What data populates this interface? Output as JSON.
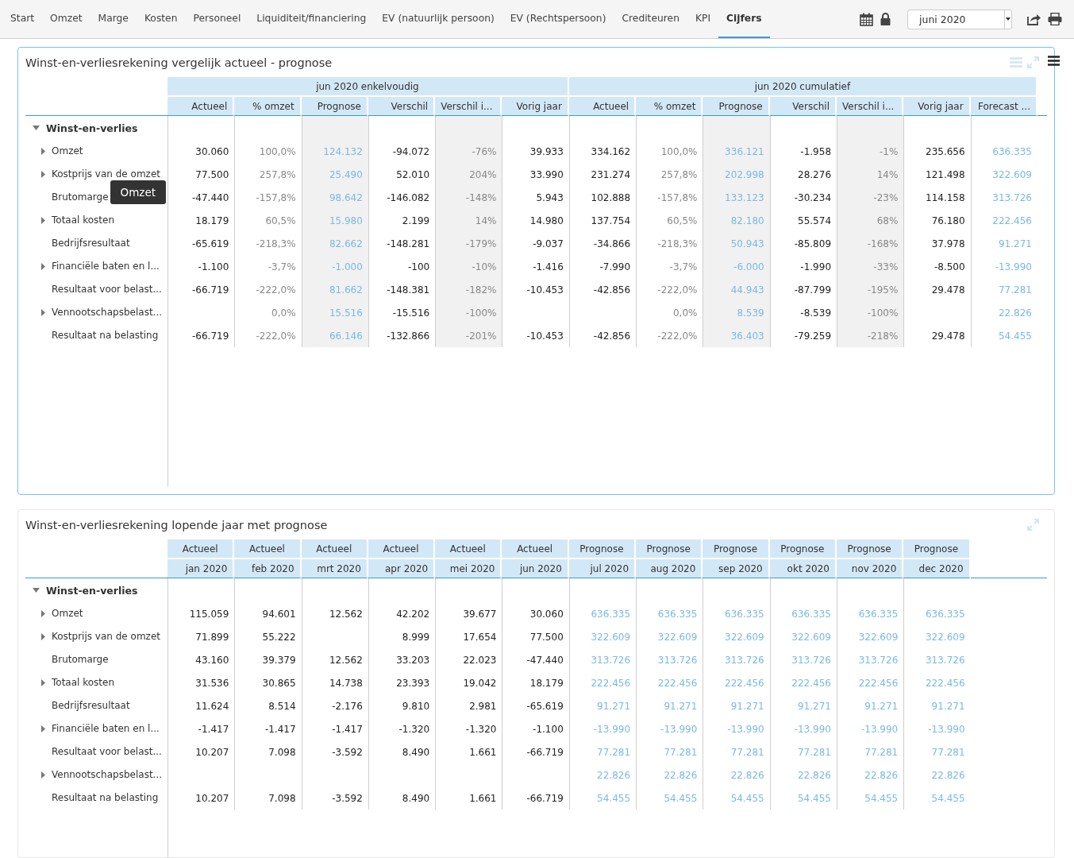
{
  "nav": {
    "items": [
      {
        "label": "Start",
        "selected": false
      },
      {
        "label": "Omzet",
        "selected": false
      },
      {
        "label": "Marge",
        "selected": false
      },
      {
        "label": "Kosten",
        "selected": false
      },
      {
        "label": "Personeel",
        "selected": false
      },
      {
        "label": "Liquiditeit/financiering",
        "selected": false
      },
      {
        "label": "EV (natuurlijk persoon)",
        "selected": false
      },
      {
        "label": "EV (Rechtspersoon)",
        "selected": false
      },
      {
        "label": "Crediteuren",
        "selected": false
      },
      {
        "label": "KPI",
        "selected": false
      },
      {
        "label": "Cijfers",
        "selected": true
      }
    ],
    "period": "juni 2020"
  },
  "panels": [
    {
      "title": "Winst-en-verliesrekening vergelijk actueel - prognose",
      "focused": true,
      "tooltip": "Omzet",
      "groups": [
        {
          "label": "jun 2020 enkelvoudig",
          "columns": [
            {
              "label": "Actueel",
              "kind": "value",
              "shaded": false
            },
            {
              "label": "% omzet",
              "kind": "pct",
              "shaded": false
            },
            {
              "label": "Prognose",
              "kind": "forecast",
              "shaded": true
            },
            {
              "label": "Verschil",
              "kind": "value",
              "shaded": false
            },
            {
              "label": "Verschil i...",
              "kind": "pct",
              "shaded": true
            },
            {
              "label": "Vorig jaar",
              "kind": "value",
              "shaded": false
            }
          ]
        },
        {
          "label": "jun 2020 cumulatief",
          "columns": [
            {
              "label": "Actueel",
              "kind": "value",
              "shaded": false
            },
            {
              "label": "% omzet",
              "kind": "pct",
              "shaded": false
            },
            {
              "label": "Prognose",
              "kind": "forecast",
              "shaded": true
            },
            {
              "label": "Verschil",
              "kind": "value",
              "shaded": false
            },
            {
              "label": "Verschil i...",
              "kind": "pct",
              "shaded": true
            },
            {
              "label": "Vorig jaar",
              "kind": "value",
              "shaded": false
            },
            {
              "label": "Forecast ...",
              "kind": "forecast",
              "shaded": false
            }
          ]
        }
      ],
      "root": {
        "label": "Winst-en-verlies",
        "expanded": true,
        "children": [
          {
            "label": "Omzet",
            "expandable": true,
            "values": [
              "30.060",
              "100,0%",
              "124.132",
              "-94.072",
              "-76%",
              "39.933",
              "334.162",
              "100,0%",
              "336.121",
              "-1.958",
              "-1%",
              "235.656",
              "636.335"
            ]
          },
          {
            "label": "Kostprijs van de omzet",
            "expandable": true,
            "values": [
              "77.500",
              "257,8%",
              "25.490",
              "52.010",
              "204%",
              "33.990",
              "231.274",
              "257,8%",
              "202.998",
              "28.276",
              "14%",
              "121.498",
              "322.609"
            ]
          },
          {
            "label": "Brutomarge",
            "expandable": false,
            "values": [
              "-47.440",
              "-157,8%",
              "98.642",
              "-146.082",
              "-148%",
              "5.943",
              "102.888",
              "-157,8%",
              "133.123",
              "-30.234",
              "-23%",
              "114.158",
              "313.726"
            ]
          },
          {
            "label": "Totaal kosten",
            "expandable": true,
            "values": [
              "18.179",
              "60,5%",
              "15.980",
              "2.199",
              "14%",
              "14.980",
              "137.754",
              "60,5%",
              "82.180",
              "55.574",
              "68%",
              "76.180",
              "222.456"
            ]
          },
          {
            "label": "Bedrijfsresultaat",
            "expandable": false,
            "values": [
              "-65.619",
              "-218,3%",
              "82.662",
              "-148.281",
              "-179%",
              "-9.037",
              "-34.866",
              "-218,3%",
              "50.943",
              "-85.809",
              "-168%",
              "37.978",
              "91.271"
            ]
          },
          {
            "label": "Financiële baten en l...",
            "expandable": true,
            "values": [
              "-1.100",
              "-3,7%",
              "-1.000",
              "-100",
              "-10%",
              "-1.416",
              "-7.990",
              "-3,7%",
              "-6.000",
              "-1.990",
              "-33%",
              "-8.500",
              "-13.990"
            ]
          },
          {
            "label": "Resultaat voor belast...",
            "expandable": false,
            "values": [
              "-66.719",
              "-222,0%",
              "81.662",
              "-148.381",
              "-182%",
              "-10.453",
              "-42.856",
              "-222,0%",
              "44.943",
              "-87.799",
              "-195%",
              "29.478",
              "77.281"
            ]
          },
          {
            "label": "Vennootschapsbelast...",
            "expandable": true,
            "values": [
              {
                "empty": true
              },
              "0,0%",
              "15.516",
              "-15.516",
              "-100%",
              {
                "empty": true
              },
              {
                "empty": true
              },
              "0,0%",
              "8.539",
              "-8.539",
              "-100%",
              {
                "empty": true
              },
              "22.826"
            ]
          },
          {
            "label": "Resultaat na belasting",
            "expandable": false,
            "values": [
              "-66.719",
              "-222,0%",
              "66.146",
              "-132.866",
              "-201%",
              "-10.453",
              "-42.856",
              "-222,0%",
              "36.403",
              "-79.259",
              "-218%",
              "29.478",
              "54.455"
            ]
          }
        ]
      }
    },
    {
      "title": "Winst-en-verliesrekening lopende jaar met prognose",
      "focused": false,
      "columns": [
        {
          "label": "Actueel",
          "sublabel": "jan 2020",
          "kind": "value"
        },
        {
          "label": "Actueel",
          "sublabel": "feb 2020",
          "kind": "value"
        },
        {
          "label": "Actueel",
          "sublabel": "mrt 2020",
          "kind": "value"
        },
        {
          "label": "Actueel",
          "sublabel": "apr 2020",
          "kind": "value"
        },
        {
          "label": "Actueel",
          "sublabel": "mei 2020",
          "kind": "value"
        },
        {
          "label": "Actueel",
          "sublabel": "jun 2020",
          "kind": "value"
        },
        {
          "label": "Prognose",
          "sublabel": "jul 2020",
          "kind": "forecast"
        },
        {
          "label": "Prognose",
          "sublabel": "aug 2020",
          "kind": "forecast"
        },
        {
          "label": "Prognose",
          "sublabel": "sep 2020",
          "kind": "forecast"
        },
        {
          "label": "Prognose",
          "sublabel": "okt 2020",
          "kind": "forecast"
        },
        {
          "label": "Prognose",
          "sublabel": "nov 2020",
          "kind": "forecast"
        },
        {
          "label": "Prognose",
          "sublabel": "dec 2020",
          "kind": "forecast"
        }
      ],
      "root": {
        "label": "Winst-en-verlies",
        "expanded": true,
        "children": [
          {
            "label": "Omzet",
            "expandable": true,
            "values": [
              "115.059",
              "94.601",
              "12.562",
              "42.202",
              "39.677",
              "30.060",
              "636.335",
              "636.335",
              "636.335",
              "636.335",
              "636.335",
              "636.335"
            ]
          },
          {
            "label": "Kostprijs van de omzet",
            "expandable": true,
            "values": [
              "71.899",
              "55.222",
              {
                "empty": true
              },
              "8.999",
              "17.654",
              "77.500",
              "322.609",
              "322.609",
              "322.609",
              "322.609",
              "322.609",
              "322.609"
            ]
          },
          {
            "label": "Brutomarge",
            "expandable": false,
            "values": [
              "43.160",
              "39.379",
              "12.562",
              "33.203",
              "22.023",
              "-47.440",
              "313.726",
              "313.726",
              "313.726",
              "313.726",
              "313.726",
              "313.726"
            ]
          },
          {
            "label": "Totaal kosten",
            "expandable": true,
            "values": [
              "31.536",
              "30.865",
              "14.738",
              "23.393",
              "19.042",
              "18.179",
              "222.456",
              "222.456",
              "222.456",
              "222.456",
              "222.456",
              "222.456"
            ]
          },
          {
            "label": "Bedrijfsresultaat",
            "expandable": false,
            "values": [
              "11.624",
              "8.514",
              "-2.176",
              "9.810",
              "2.981",
              "-65.619",
              "91.271",
              "91.271",
              "91.271",
              "91.271",
              "91.271",
              "91.271"
            ]
          },
          {
            "label": "Financiële baten en l...",
            "expandable": true,
            "values": [
              "-1.417",
              "-1.417",
              "-1.417",
              "-1.320",
              "-1.320",
              "-1.100",
              "-13.990",
              "-13.990",
              "-13.990",
              "-13.990",
              "-13.990",
              "-13.990"
            ]
          },
          {
            "label": "Resultaat voor belast...",
            "expandable": false,
            "values": [
              "10.207",
              "7.098",
              "-3.592",
              "8.490",
              "1.661",
              "-66.719",
              "77.281",
              "77.281",
              "77.281",
              "77.281",
              "77.281",
              "77.281"
            ]
          },
          {
            "label": "Vennootschapsbelast...",
            "expandable": true,
            "values": [
              {
                "empty": true
              },
              {
                "empty": true
              },
              {
                "empty": true
              },
              {
                "empty": true
              },
              {
                "empty": true
              },
              {
                "empty": true
              },
              "22.826",
              "22.826",
              "22.826",
              "22.826",
              "22.826",
              "22.826"
            ]
          },
          {
            "label": "Resultaat na belasting",
            "expandable": false,
            "values": [
              "10.207",
              "7.098",
              "-3.592",
              "8.490",
              "1.661",
              "-66.719",
              "54.455",
              "54.455",
              "54.455",
              "54.455",
              "54.455",
              "54.455"
            ]
          }
        ]
      }
    }
  ]
}
